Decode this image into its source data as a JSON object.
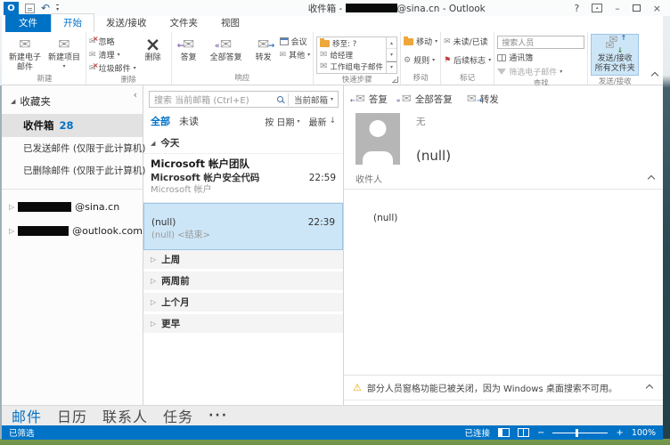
{
  "colors": {
    "accent": "#0072c6",
    "list_selection": "#cde6f7",
    "status_bar_bg": "#0173c7",
    "warning_icon": "#e9a400"
  },
  "title_bar": {
    "title_prefix": "收件箱 - ",
    "title_suffix": "@sina.cn - Outlook",
    "help": "?",
    "minimize": "–",
    "close": "×"
  },
  "ribbon_tabs": {
    "file": "文件",
    "home": "开始",
    "send_receive": "发送/接收",
    "folder": "文件夹",
    "view": "视图"
  },
  "ribbon": {
    "new_group": {
      "label": "新建",
      "new_email": "新建电子邮件",
      "new_items": "新建项目"
    },
    "delete_group": {
      "label": "删除",
      "ignore": "忽略",
      "cleanup": "清理",
      "junk": "垃圾邮件",
      "delete": "删除"
    },
    "respond_group": {
      "label": "响应",
      "reply": "答复",
      "reply_all": "全部答复",
      "forward": "转发",
      "meeting": "会议",
      "more": "其他"
    },
    "quick_steps_group": {
      "label": "快速步骤",
      "move_to": "移至: ?",
      "to_manager": "给经理",
      "team_email": "工作组电子邮件"
    },
    "move_group": {
      "label": "移动",
      "move": "移动",
      "rules": "规则"
    },
    "tags_group": {
      "label": "标记",
      "unread_read": "未读/已读",
      "follow_up": "后续标志"
    },
    "find_group": {
      "label": "查找",
      "search_people": "搜索人员",
      "address_book": "通讯簿",
      "filter_email": "筛选电子邮件"
    },
    "send_receive_group": {
      "label": "发送/接收",
      "send_receive_all": "发送/接收所有文件夹"
    }
  },
  "folder_pane": {
    "favorites": "收藏夹",
    "inbox": "收件箱",
    "inbox_count": "28",
    "sent": "已发送邮件 (仅限于此计算机)",
    "deleted": "已删除邮件 (仅限于此计算机)",
    "account1_domain": "@sina.cn",
    "account2_domain": "@outlook.com"
  },
  "message_list": {
    "search_placeholder": "搜索 当前邮箱 (Ctrl+E)",
    "scope": "当前邮箱",
    "tab_all": "全部",
    "tab_unread": "未读",
    "sort_by": "按 日期",
    "sort_newest": "最新",
    "group_today": "今天",
    "message_1": {
      "sender": "Microsoft 帐户团队",
      "subject": "Microsoft 帐户安全代码",
      "time": "22:59",
      "preview": "Microsoft 帐户"
    },
    "message_2": {
      "title": "(null)",
      "time": "22:39",
      "preview": "(null) <结束>"
    },
    "group_last_week": "上周",
    "group_two_weeks_ago": "两周前",
    "group_last_month": "上个月",
    "group_older": "更早"
  },
  "reading_pane": {
    "reply": "答复",
    "reply_all": "全部答复",
    "forward": "转发",
    "sender_name": "无",
    "subject": "(null)",
    "recipients_label": "收件人",
    "body": "(null)",
    "warning": "部分人员窗格功能已被关闭，因为 Windows 桌面搜索不可用。"
  },
  "nav_bar": {
    "mail": "邮件",
    "calendar": "日历",
    "people": "联系人",
    "tasks": "任务",
    "more": "···"
  },
  "status_bar": {
    "filter_state": "已筛选",
    "connection": "已连接",
    "zoom_level": "100%"
  }
}
